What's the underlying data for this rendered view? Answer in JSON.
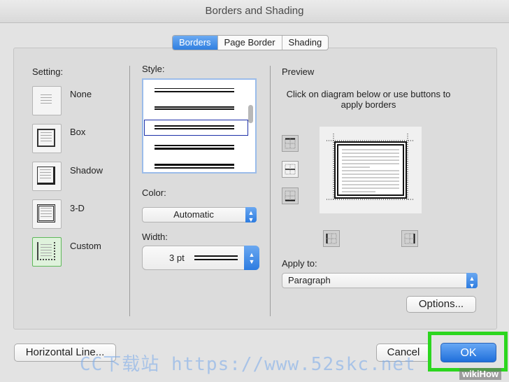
{
  "window": {
    "title": "Borders and Shading"
  },
  "tabs": [
    {
      "label": "Borders",
      "active": true
    },
    {
      "label": "Page Border",
      "active": false
    },
    {
      "label": "Shading",
      "active": false
    }
  ],
  "setting": {
    "label": "Setting:",
    "options": [
      "None",
      "Box",
      "Shadow",
      "3-D",
      "Custom"
    ],
    "selected": "Custom"
  },
  "style": {
    "label": "Style:"
  },
  "color": {
    "label": "Color:",
    "value": "Automatic"
  },
  "width": {
    "label": "Width:",
    "value": "3 pt"
  },
  "preview": {
    "label": "Preview",
    "instructions": "Click on diagram below or use buttons to apply borders"
  },
  "apply_to": {
    "label": "Apply to:",
    "value": "Paragraph"
  },
  "buttons": {
    "options": "Options...",
    "horizontal_line": "Horizontal Line...",
    "cancel": "Cancel",
    "ok": "OK"
  },
  "overlay": {
    "watermark": "CC下载站 https://www.52skc.net",
    "credit": "wikiHow"
  },
  "colors": {
    "accent": "#2f7fe0",
    "highlight": "#2cd61f"
  }
}
